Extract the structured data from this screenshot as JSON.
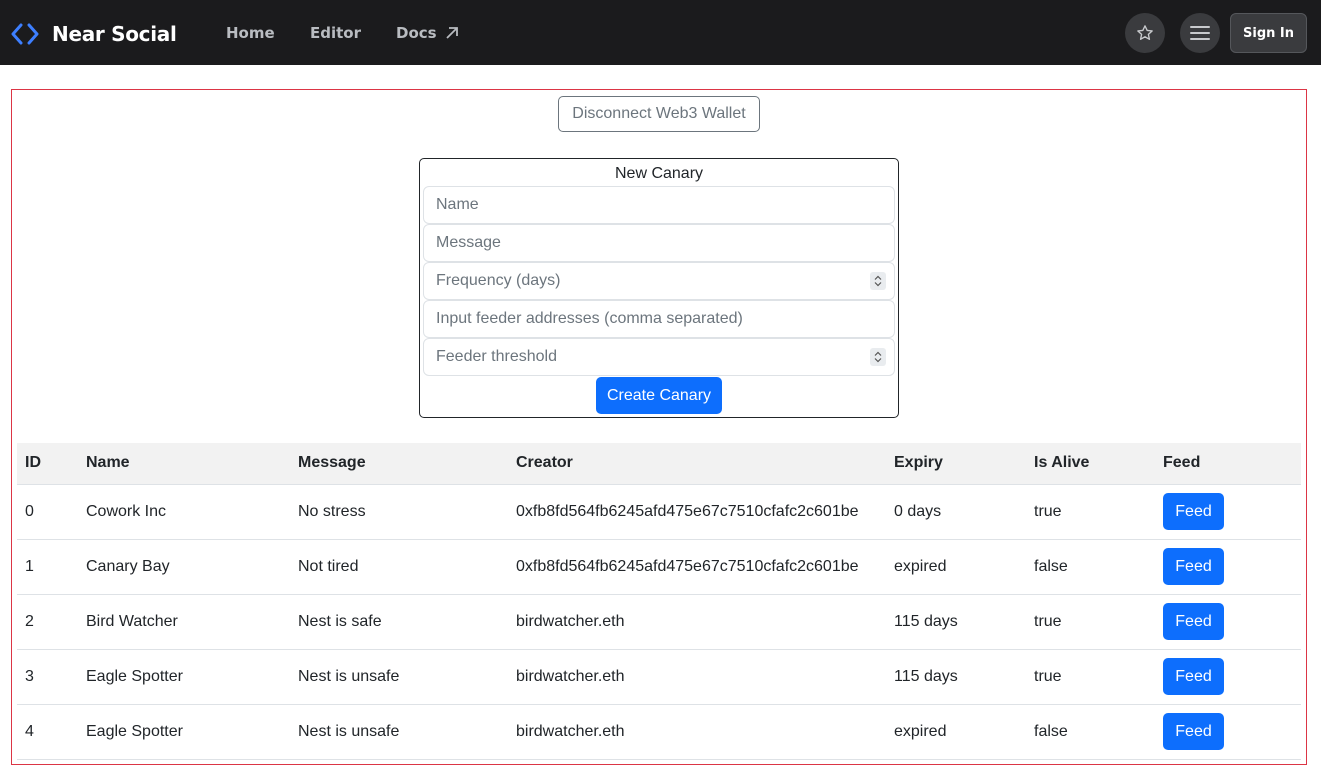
{
  "brand": {
    "name": "Near Social",
    "accent": "#3d7fff"
  },
  "nav": {
    "home": "Home",
    "editor": "Editor",
    "docs": "Docs",
    "sign_in": "Sign In",
    "icons": [
      "star-icon",
      "hamburger-menu-icon",
      "external-arrow-icon"
    ]
  },
  "wallet": {
    "disconnect_label": "Disconnect Web3 Wallet"
  },
  "form": {
    "title": "New Canary",
    "name_placeholder": "Name",
    "message_placeholder": "Message",
    "frequency_placeholder": "Frequency (days)",
    "feeders_placeholder": "Input feeder addresses (comma separated)",
    "threshold_placeholder": "Feeder threshold",
    "create_label": "Create Canary",
    "button_color": "#0d6efd"
  },
  "table": {
    "headers": [
      "ID",
      "Name",
      "Message",
      "Creator",
      "Expiry",
      "Is Alive",
      "Feed"
    ],
    "feed_label": "Feed",
    "rows": [
      {
        "id": "0",
        "name": "Cowork Inc",
        "message": "No stress",
        "creator": "0xfb8fd564fb6245afd475e67c7510cfafc2c601be",
        "expiry": "0 days",
        "alive": "true"
      },
      {
        "id": "1",
        "name": "Canary Bay",
        "message": "Not tired",
        "creator": "0xfb8fd564fb6245afd475e67c7510cfafc2c601be",
        "expiry": "expired",
        "alive": "false"
      },
      {
        "id": "2",
        "name": "Bird Watcher",
        "message": "Nest is safe",
        "creator": "birdwatcher.eth",
        "expiry": "115 days",
        "alive": "true"
      },
      {
        "id": "3",
        "name": "Eagle Spotter",
        "message": "Nest is unsafe",
        "creator": "birdwatcher.eth",
        "expiry": "115 days",
        "alive": "true"
      },
      {
        "id": "4",
        "name": "Eagle Spotter",
        "message": "Nest is unsafe",
        "creator": "birdwatcher.eth",
        "expiry": "expired",
        "alive": "false"
      }
    ]
  }
}
